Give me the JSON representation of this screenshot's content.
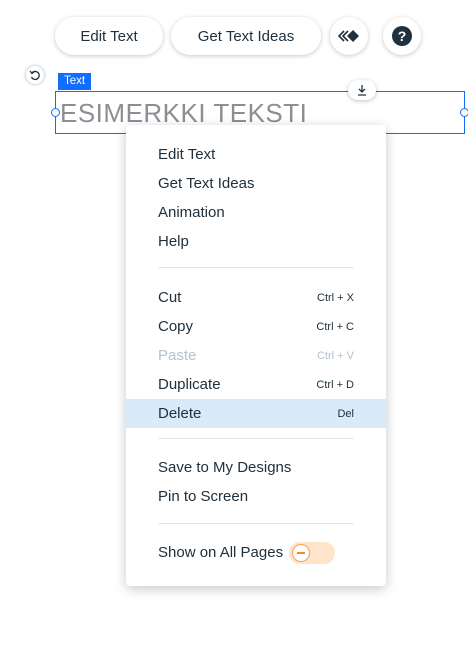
{
  "toolbar": {
    "edit_text_label": "Edit Text",
    "get_text_ideas_label": "Get Text Ideas",
    "animation_icon": "animation-icon",
    "help_icon": "help-icon",
    "help_glyph": "?"
  },
  "element": {
    "type_tag": "Text",
    "sample_text": "ESIMERKKI TEKSTI"
  },
  "context_menu": {
    "edit_text": "Edit Text",
    "get_text_ideas": "Get Text Ideas",
    "animation": "Animation",
    "help": "Help",
    "cut": "Cut",
    "cut_shortcut": "Ctrl + X",
    "copy": "Copy",
    "copy_shortcut": "Ctrl + C",
    "paste": "Paste",
    "paste_shortcut": "Ctrl + V",
    "duplicate": "Duplicate",
    "duplicate_shortcut": "Ctrl + D",
    "delete": "Delete",
    "delete_shortcut": "Del",
    "save_to_my_designs": "Save to My Designs",
    "pin_to_screen": "Pin to Screen",
    "show_on_all_pages": "Show on All Pages",
    "show_on_all_pages_enabled": false
  },
  "colors": {
    "selection_blue": "#116dff",
    "hover_row": "#d9eaf8",
    "toggle_off_bg": "#fde4cb",
    "toggle_off_accent": "#f18a2a",
    "disabled_text": "#b6c1cd"
  }
}
